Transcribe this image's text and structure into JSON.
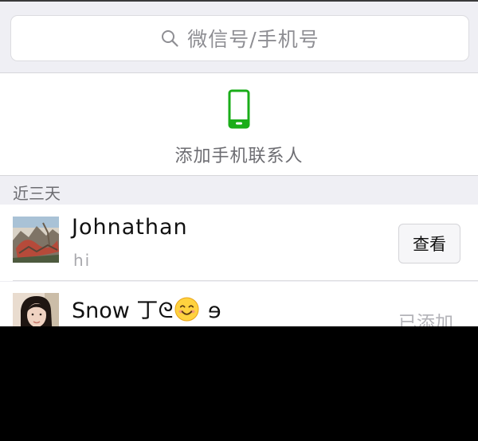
{
  "search": {
    "placeholder": "微信号/手机号"
  },
  "add_contacts": {
    "label": "添加手机联系人",
    "icon": "phone-icon",
    "icon_color": "#1aad19"
  },
  "section": {
    "header": "近三天"
  },
  "contacts": [
    {
      "name": "Johnathan",
      "message": "hi",
      "action": "查看",
      "avatar": "avatar-landscape-image"
    },
    {
      "name_prefix": "Snow 丁",
      "name_emoji": "smiling-face-emoji",
      "name_suffix": "ℶ",
      "status": "已添加",
      "avatar": "avatar-person-photo"
    }
  ]
}
